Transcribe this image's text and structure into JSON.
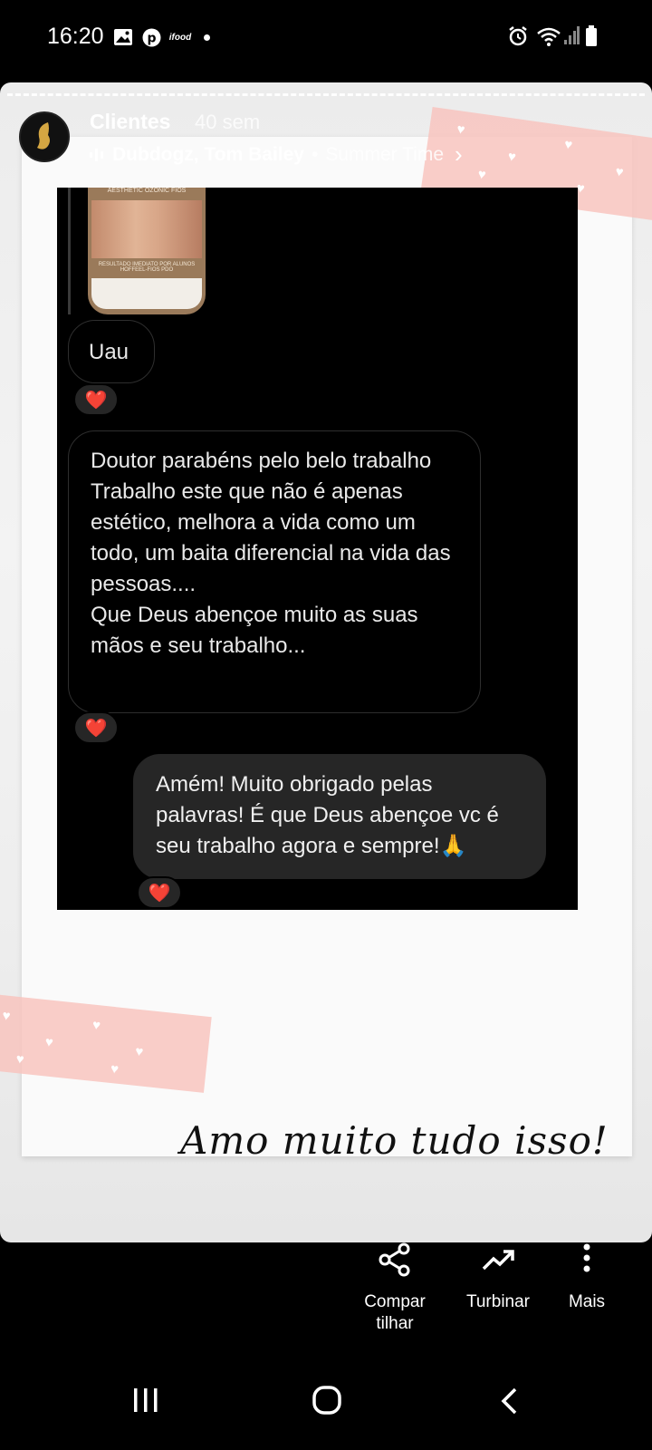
{
  "status_bar": {
    "time": "16:20",
    "left_icons": [
      "gallery-icon",
      "pinterest-icon",
      "ifood-icon",
      "dot-icon"
    ],
    "ifood_label": "ifood",
    "right_icons": [
      "alarm-icon",
      "wifi-icon",
      "signal-icon",
      "battery-icon"
    ]
  },
  "story": {
    "username": "Clientes",
    "time_ago": "40 sem",
    "music": {
      "artist": "Dubdogz, Tom Bailey",
      "separator": "•",
      "song": "Summer Time",
      "chevron": "›"
    }
  },
  "chat": {
    "thumbnail_top": "AESTHETIC OZONIC FIOS",
    "thumbnail_caption": "RESULTADO IMEDIATO POR ALUNOS HOFFEEL-FIOS PDO",
    "messages": [
      {
        "side": "left",
        "text": "Uau",
        "reaction": "❤️"
      },
      {
        "side": "left",
        "text": "Doutor parabéns pelo belo trabalho\nTrabalho este que não é apenas estético, melhora a vida como um todo, um baita diferencial na vida das pessoas....\nQue Deus abençoe muito as suas mãos e seu trabalho...",
        "reaction": "❤️"
      },
      {
        "side": "right",
        "text": "Amém! Muito obrigado pelas palavras! É que Deus abençoe vc é seu trabalho agora e sempre!🙏",
        "reaction": "❤️"
      }
    ]
  },
  "caption": "Amo muito tudo isso!",
  "actions": [
    {
      "label_line1": "Compar",
      "label_line2": "tilhar",
      "icon": "share-icon"
    },
    {
      "label_line1": "Turbinar",
      "label_line2": "",
      "icon": "boost-icon"
    },
    {
      "label_line1": "Mais",
      "label_line2": "",
      "icon": "more-icon"
    }
  ],
  "navbar": {
    "icons": [
      "recent-apps-icon",
      "home-icon",
      "back-icon"
    ]
  }
}
